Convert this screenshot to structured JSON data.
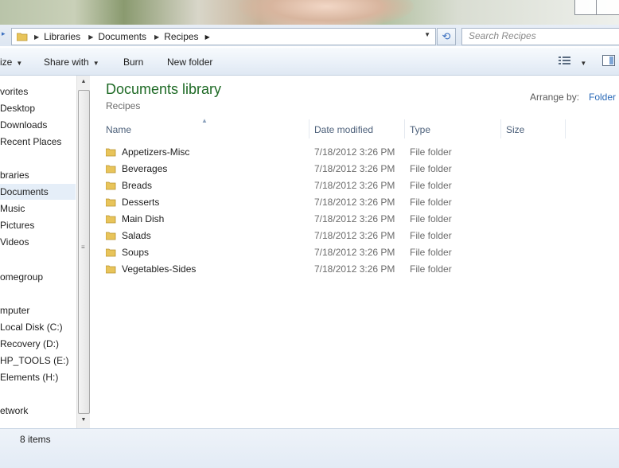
{
  "address_bar": {
    "breadcrumbs": [
      "Libraries",
      "Documents",
      "Recipes"
    ],
    "search_placeholder": "Search Recipes"
  },
  "toolbar": {
    "organize_label": "ize",
    "share_label": "Share with",
    "burn_label": "Burn",
    "new_folder_label": "New folder"
  },
  "nav": {
    "items": [
      {
        "label": "vorites"
      },
      {
        "label": "Desktop"
      },
      {
        "label": "Downloads"
      },
      {
        "label": "Recent Places"
      },
      {
        "label": "braries"
      },
      {
        "label": "Documents"
      },
      {
        "label": "Music"
      },
      {
        "label": "Pictures"
      },
      {
        "label": "Videos"
      },
      {
        "label": "omegroup"
      },
      {
        "label": "mputer"
      },
      {
        "label": "Local Disk (C:)"
      },
      {
        "label": "Recovery (D:)"
      },
      {
        "label": "HP_TOOLS (E:)"
      },
      {
        "label": "Elements (H:)"
      },
      {
        "label": "etwork"
      }
    ],
    "selected": "Documents"
  },
  "library": {
    "title": "Documents library",
    "subtitle": "Recipes",
    "arrange_label": "Arrange by:",
    "arrange_value": "Folder"
  },
  "columns": {
    "name": "Name",
    "date": "Date modified",
    "type": "Type",
    "size": "Size"
  },
  "files": [
    {
      "name": "Appetizers-Misc",
      "date": "7/18/2012 3:26 PM",
      "type": "File folder"
    },
    {
      "name": "Beverages",
      "date": "7/18/2012 3:26 PM",
      "type": "File folder"
    },
    {
      "name": "Breads",
      "date": "7/18/2012 3:26 PM",
      "type": "File folder"
    },
    {
      "name": "Desserts",
      "date": "7/18/2012 3:26 PM",
      "type": "File folder"
    },
    {
      "name": "Main Dish",
      "date": "7/18/2012 3:26 PM",
      "type": "File folder"
    },
    {
      "name": "Salads",
      "date": "7/18/2012 3:26 PM",
      "type": "File folder"
    },
    {
      "name": "Soups",
      "date": "7/18/2012 3:26 PM",
      "type": "File folder"
    },
    {
      "name": "Vegetables-Sides",
      "date": "7/18/2012 3:26 PM",
      "type": "File folder"
    }
  ],
  "status": {
    "item_count": "8 items"
  },
  "colors": {
    "library_title": "#1e6a25",
    "link": "#2a6ab8",
    "folder": "#e8c45a"
  }
}
